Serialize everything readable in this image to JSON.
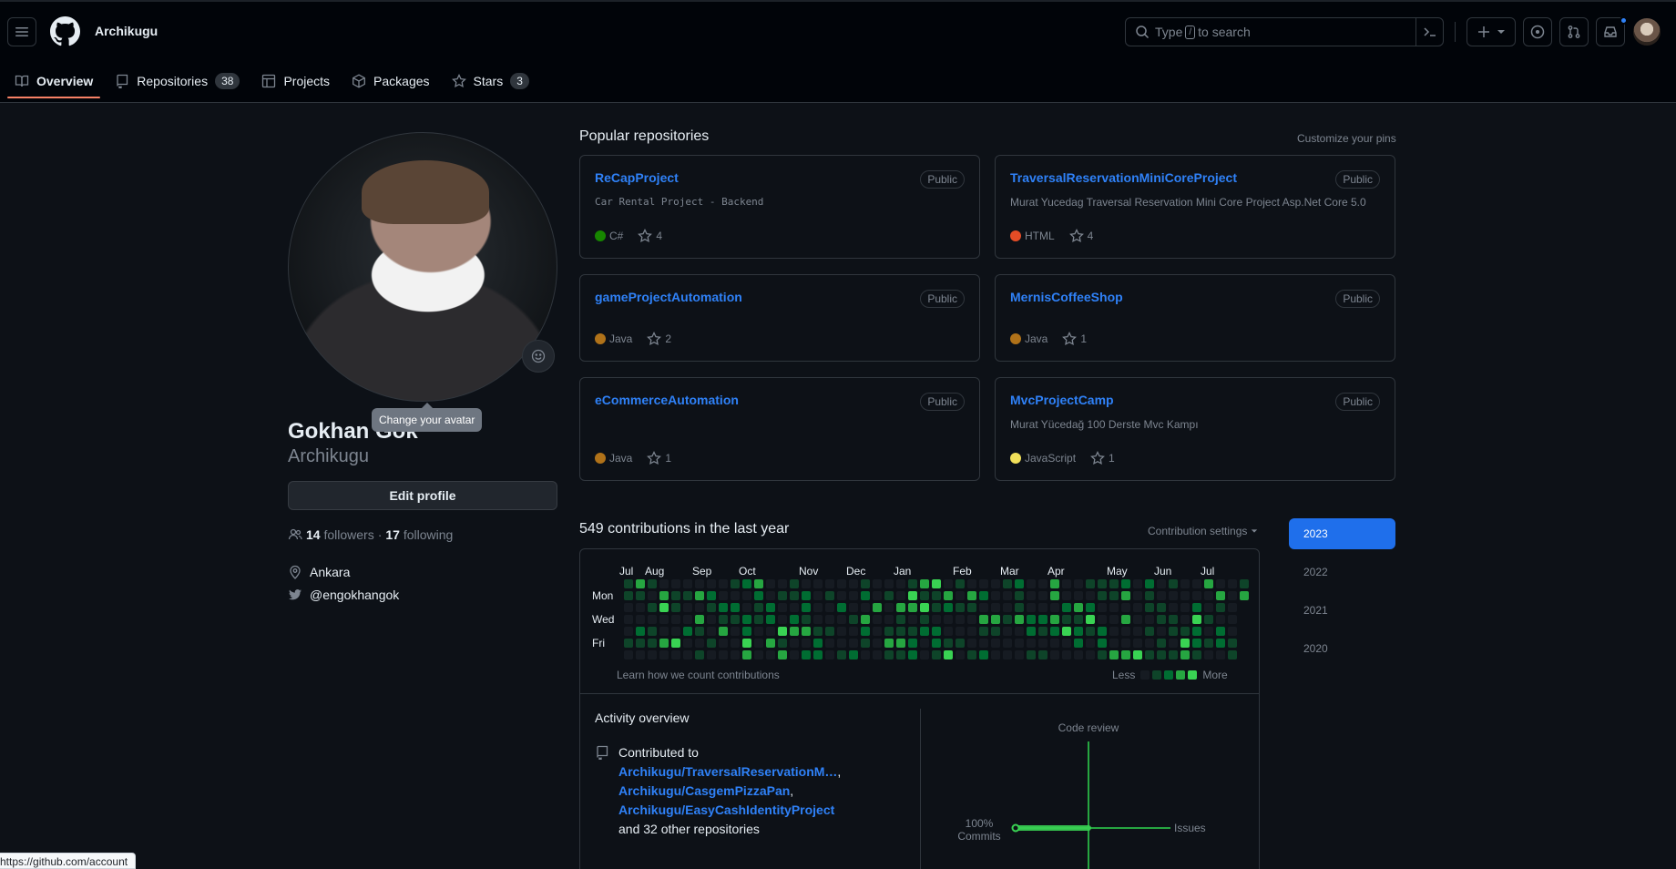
{
  "header": {
    "owner": "Archikugu",
    "search_prefix": "Type",
    "search_key": "/",
    "search_suffix": "to search"
  },
  "tabs": [
    {
      "label": "Overview",
      "icon": "book-icon",
      "active": true
    },
    {
      "label": "Repositories",
      "icon": "repo-icon",
      "count": "38"
    },
    {
      "label": "Projects",
      "icon": "table-icon"
    },
    {
      "label": "Packages",
      "icon": "package-icon"
    },
    {
      "label": "Stars",
      "icon": "star-icon",
      "count": "3"
    }
  ],
  "profile": {
    "name": "Gokhan Gok",
    "login": "Archikugu",
    "tooltip": "Change your avatar",
    "edit_label": "Edit profile",
    "followers_count": "14",
    "followers_label": "followers",
    "dot": "·",
    "following_count": "17",
    "following_label": "following",
    "location": "Ankara",
    "twitter": "@engokhangok"
  },
  "popular": {
    "title": "Popular repositories",
    "customize": "Customize your pins",
    "repos": [
      {
        "name": "ReCapProject",
        "visibility": "Public",
        "desc": "Car Rental Project - Backend",
        "lang": "C#",
        "color": "#178600",
        "stars": "4"
      },
      {
        "name": "TraversalReservationMiniCoreProject",
        "visibility": "Public",
        "desc": "Murat Yucedag Traversal Reservation Mini Core Project Asp.Net Core 5.0",
        "lang": "HTML",
        "color": "#e34c26",
        "stars": "4"
      },
      {
        "name": "gameProjectAutomation",
        "visibility": "Public",
        "desc": "",
        "lang": "Java",
        "color": "#b07219",
        "stars": "2"
      },
      {
        "name": "MernisCoffeeShop",
        "visibility": "Public",
        "desc": "",
        "lang": "Java",
        "color": "#b07219",
        "stars": "1"
      },
      {
        "name": "eCommerceAutomation",
        "visibility": "Public",
        "desc": "",
        "lang": "Java",
        "color": "#b07219",
        "stars": "1"
      },
      {
        "name": "MvcProjectCamp",
        "visibility": "Public",
        "desc": "Murat Yücedağ 100 Derste Mvc Kampı",
        "lang": "JavaScript",
        "color": "#f1e05a",
        "stars": "1"
      }
    ]
  },
  "contrib": {
    "title": "549 contributions in the last year",
    "settings": "Contribution settings",
    "months": [
      "Jul",
      "Aug",
      "Sep",
      "Oct",
      "Nov",
      "Dec",
      "Jan",
      "Feb",
      "Mar",
      "Apr",
      "May",
      "Jun",
      "Jul"
    ],
    "days": [
      "Mon",
      "Wed",
      "Fri"
    ],
    "learn": "Learn how we count contributions",
    "less": "Less",
    "more": "More",
    "levels": [
      "#161b22",
      "#0e4429",
      "#006d32",
      "#26a641",
      "#39d353"
    ]
  },
  "years": [
    "2023",
    "2022",
    "2021",
    "2020"
  ],
  "activity": {
    "title": "Activity overview",
    "contributed_to": "Contributed to",
    "repos": [
      "Archikugu/TraversalReservationM…",
      "Archikugu/CasgemPizzaPan",
      "Archikugu/EasyCashIdentityProject"
    ],
    "comma": ",",
    "others": "and 32 other repositories",
    "code_review": "Code review",
    "issues": "Issues",
    "commits_pct": "100%",
    "commits": "Commits"
  },
  "status_url": "https://github.com/account"
}
